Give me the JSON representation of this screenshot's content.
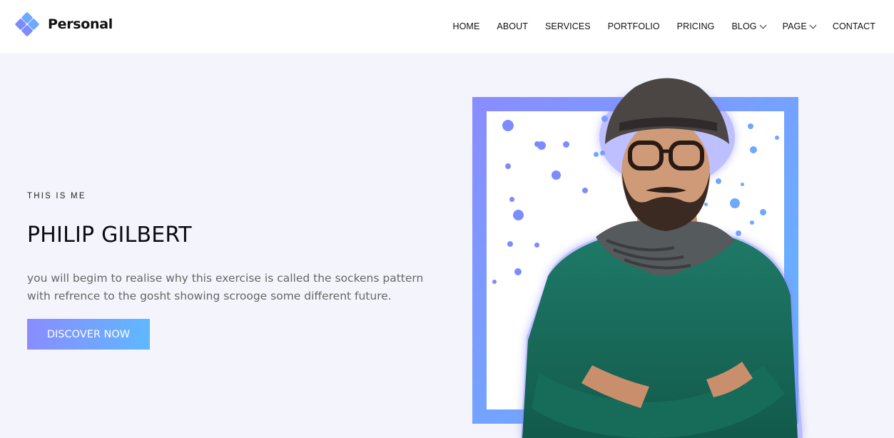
{
  "brand": {
    "name": "Personal"
  },
  "nav": {
    "items": [
      {
        "label": "HOME",
        "has_dropdown": false
      },
      {
        "label": "ABOUT",
        "has_dropdown": false
      },
      {
        "label": "SERVICES",
        "has_dropdown": false
      },
      {
        "label": "PORTFOLIO",
        "has_dropdown": false
      },
      {
        "label": "PRICING",
        "has_dropdown": false
      },
      {
        "label": "BLOG",
        "has_dropdown": true
      },
      {
        "label": "PAGE",
        "has_dropdown": true
      },
      {
        "label": "CONTACT",
        "has_dropdown": false
      }
    ]
  },
  "hero": {
    "eyebrow": "THIS IS ME",
    "title": "PHILIP GILBERT",
    "description": "you will begim to realise why this exercise is called the sockens pattern with refrence to the gosht showing scrooge some different future.",
    "cta_label": "DISCOVER NOW"
  },
  "colors": {
    "accent_start": "#8a8cff",
    "accent_end": "#5fb8ff",
    "background": "#f4f5fc"
  },
  "icons": {
    "logo": "diamond-cluster-icon",
    "dropdown": "chevron-down-icon"
  }
}
